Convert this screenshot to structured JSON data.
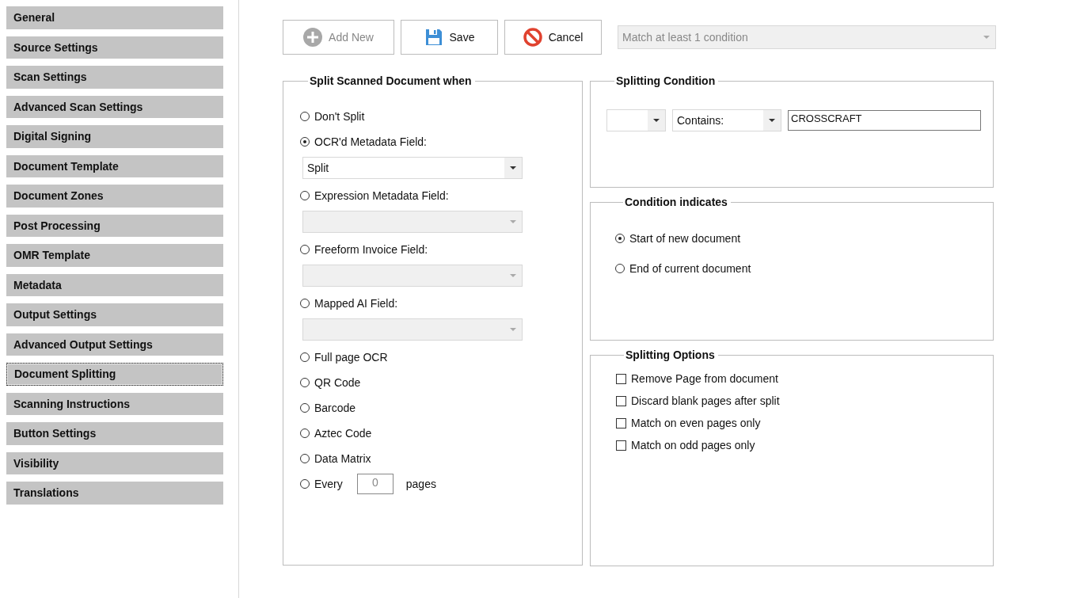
{
  "sidebar": {
    "items": [
      {
        "label": "General",
        "selected": false
      },
      {
        "label": "Source Settings",
        "selected": false
      },
      {
        "label": "Scan Settings",
        "selected": false
      },
      {
        "label": "Advanced Scan Settings",
        "selected": false
      },
      {
        "label": "Digital Signing",
        "selected": false
      },
      {
        "label": "Document Template",
        "selected": false
      },
      {
        "label": "Document Zones",
        "selected": false
      },
      {
        "label": "Post Processing",
        "selected": false
      },
      {
        "label": "OMR Template",
        "selected": false
      },
      {
        "label": "Metadata",
        "selected": false
      },
      {
        "label": "Output Settings",
        "selected": false
      },
      {
        "label": "Advanced Output Settings",
        "selected": false
      },
      {
        "label": "Document Splitting",
        "selected": true
      },
      {
        "label": "Scanning Instructions",
        "selected": false
      },
      {
        "label": "Button Settings",
        "selected": false
      },
      {
        "label": "Visibility",
        "selected": false
      },
      {
        "label": "Translations",
        "selected": false
      }
    ]
  },
  "toolbar": {
    "buttons": [
      {
        "kind": "add",
        "label": "Add New",
        "disabled": true
      },
      {
        "kind": "save",
        "label": "Save",
        "disabled": false
      },
      {
        "kind": "cancel",
        "label": "Cancel",
        "disabled": false
      }
    ],
    "match_mode": {
      "value": "Match at least 1 condition",
      "disabled": true
    }
  },
  "split_when": {
    "title": "Split Scanned Document when",
    "options": [
      {
        "kind": "radio",
        "label": "Don't Split",
        "selected": false
      },
      {
        "kind": "dropdown",
        "label": "OCR'd Metadata Field:",
        "selected": true,
        "dropdown": {
          "value": "Split",
          "disabled": false
        }
      },
      {
        "kind": "dropdown",
        "label": "Expression Metadata Field:",
        "selected": false,
        "dropdown": {
          "disabled": true
        }
      },
      {
        "kind": "dropdown",
        "label": "Freeform Invoice Field:",
        "selected": false,
        "dropdown": {
          "disabled": true
        }
      },
      {
        "kind": "dropdown",
        "label": "Mapped AI Field:",
        "selected": false,
        "dropdown": {
          "disabled": true
        }
      },
      {
        "kind": "radio",
        "label": "Full page OCR",
        "selected": false
      },
      {
        "kind": "radio",
        "label": "QR Code",
        "selected": false
      },
      {
        "kind": "radio",
        "label": "Barcode",
        "selected": false
      },
      {
        "kind": "radio",
        "label": "Aztec Code",
        "selected": false
      },
      {
        "kind": "radio",
        "label": "Data Matrix",
        "selected": false
      },
      {
        "kind": "every",
        "label": "Every",
        "selected": false,
        "value": "0",
        "suffix": "pages"
      }
    ]
  },
  "splitting_condition": {
    "title": "Splitting Condition",
    "operator": "Contains:",
    "text": "CROSSCRAFT"
  },
  "condition_indicates": {
    "title": "Condition indicates",
    "options": [
      {
        "label": "Start of new document",
        "selected": true
      },
      {
        "label": "End of current document",
        "selected": false
      }
    ]
  },
  "splitting_options": {
    "title": "Splitting Options",
    "options": [
      {
        "label": "Remove Page from document",
        "checked": false
      },
      {
        "label": "Discard blank pages after split",
        "checked": false
      },
      {
        "label": "Match on even pages only",
        "checked": false
      },
      {
        "label": "Match on odd pages only",
        "checked": false
      }
    ]
  }
}
